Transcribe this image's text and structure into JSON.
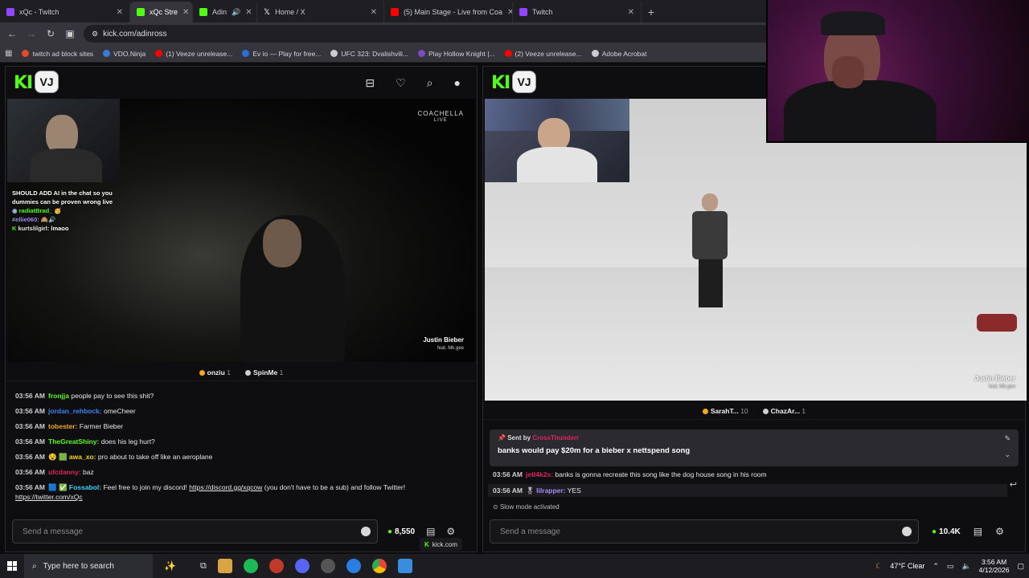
{
  "browser": {
    "tabs": [
      {
        "label": "xQc - Twitch",
        "color": "#9146ff"
      },
      {
        "label": "xQc Stre",
        "color": "#53fc18"
      },
      {
        "label": "Adin",
        "color": "#53fc18"
      },
      {
        "label": "Home / X",
        "color": "#ffffff"
      },
      {
        "label": "(5) Main Stage - Live from Coa",
        "color": "#ff0000"
      },
      {
        "label": "Twitch",
        "color": "#9146ff"
      }
    ],
    "new_tab": "+",
    "url": "kick.com/adinross",
    "bookmarks": [
      {
        "label": "twitch ad block sites",
        "color": "#e34b2c"
      },
      {
        "label": "VDO.Ninja",
        "color": "#3a7bd5"
      },
      {
        "label": "(1) Veeze unrelease...",
        "color": "#ff0000"
      },
      {
        "label": "Ev io — Play for free...",
        "color": "#2b6fd6"
      },
      {
        "label": "UFC 323: Dvalishvili...",
        "color": "#cccccc"
      },
      {
        "label": "Play Hollow Knight |...",
        "color": "#7a4cc2"
      },
      {
        "label": "(2) Veeze unrelease...",
        "color": "#ff0000"
      },
      {
        "label": "Adobe Acrobat",
        "color": "#cccccc"
      }
    ]
  },
  "left": {
    "logo": "KI",
    "vj": "VJ",
    "overlay_chat": [
      {
        "text": "SHOULD ADD AI in the chat so you dummies can be proven wrong live",
        "user": ""
      },
      {
        "user": "radiatBrad_",
        "text": ""
      },
      {
        "user": "ellie060:",
        "text": ""
      },
      {
        "user": "kurtslilgirl:",
        "text": "lmaoo"
      }
    ],
    "coachella": [
      "COACHELLA",
      "LIVE"
    ],
    "artist": "Justin Bieber",
    "artist_sub": "feat. Mk.gee",
    "viewers": [
      {
        "name": "onziu",
        "count": "1",
        "color": "#f5a623"
      },
      {
        "name": "SpinMe",
        "count": "1",
        "color": "#cfcfcf"
      }
    ],
    "chat": [
      {
        "ts": "03:56 AM",
        "user": "fronjja",
        "color": "#53fc18",
        "text": "people pay to see this shit?"
      },
      {
        "ts": "03:56 AM",
        "user": "jordan_rehbock:",
        "color": "#3b82f6",
        "text": "omeCheer"
      },
      {
        "ts": "03:56 AM",
        "user": "tobester:",
        "color": "#f5a623",
        "text": "Farmer Bieber"
      },
      {
        "ts": "03:56 AM",
        "user": "TheGreatShiny:",
        "color": "#53fc18",
        "text": "does his leg hurt?"
      },
      {
        "ts": "03:56 AM",
        "user": "awa_xo:",
        "color": "#f5d90a",
        "text": "pro about to take off like an aeroplane"
      },
      {
        "ts": "03:56 AM",
        "user": "ufcdanny:",
        "color": "#e0245e",
        "text": "baz"
      },
      {
        "ts": "03:56 AM",
        "user": "Fossabol:",
        "color": "#3bd1f5",
        "text": "Feel free to join my discord! ",
        "link": "https://discord.gg/xqcow",
        "after": " (you don't have to be a sub) and follow Twitter!",
        "link2": "https://twitter.com/xQc"
      }
    ],
    "input_placeholder": "Send a message",
    "count": "8,550"
  },
  "right": {
    "logo": "KI",
    "vj": "VJ",
    "artist": "Justin Bieber",
    "artist_sub": "feat. Mk.gee",
    "viewers": [
      {
        "name": "SarahT...",
        "count": "10",
        "color": "#f5a623"
      },
      {
        "name": "ChazAr...",
        "count": "1",
        "color": "#cfcfcf"
      }
    ],
    "pinned_label": "Sent by",
    "pinned_user": "CrossThunderr",
    "pinned_text": "banks would pay $20m for a bieber x nettspend song",
    "chat": [
      {
        "ts": "03:56 AM",
        "user": "jetl4k2s:",
        "color": "#e0245e",
        "text": "banks is gonna recreate this song like the dog house song in his room"
      },
      {
        "ts": "03:56 AM",
        "user": "lilrapper:",
        "color": "#a78bfa",
        "text": "YES"
      }
    ],
    "slow_mode": "Slow mode activated",
    "input_placeholder": "Send a message",
    "count": "10.4K",
    "kick_domain": "kick.com"
  },
  "taskbar": {
    "search": "Type here to search",
    "weather": "47°F  Clear",
    "time": "3:56 AM",
    "date": "4/12/2026"
  }
}
